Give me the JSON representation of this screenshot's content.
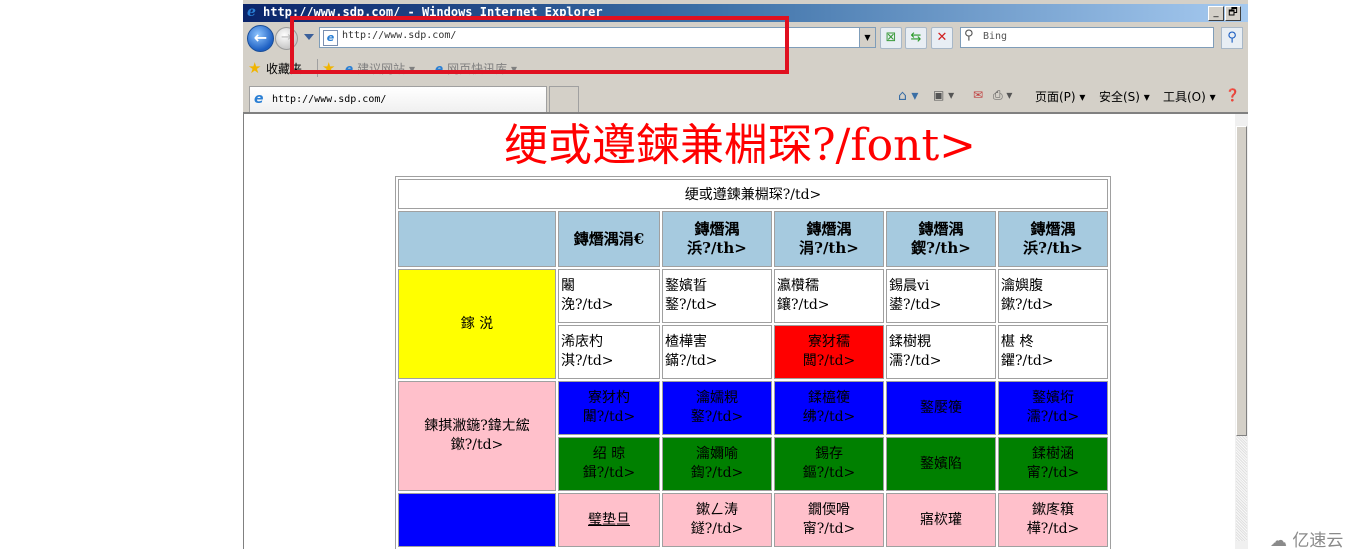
{
  "window": {
    "title": "http://www.sdp.com/ - Windows Internet Explorer",
    "controls": {
      "minimize": "_",
      "restore": "🗗"
    }
  },
  "nav": {
    "address": "http://www.sdp.com/",
    "search_placeholder": "Bing"
  },
  "favorites_bar": {
    "label": "收藏夹",
    "links": [
      {
        "label": "建议网站 ▾"
      },
      {
        "label": "网页快讯库 ▾"
      }
    ]
  },
  "tabs": [
    {
      "label": "http://www.sdp.com/"
    }
  ],
  "command_bar": {
    "page": "页面(P) ▾",
    "safety": "安全(S) ▾",
    "tools": "工具(O) ▾"
  },
  "page": {
    "heading": "绠或遵鍊兼棩琛?/font>",
    "table_caption": "绠或遵鍊兼棩琛?/td>",
    "headers": [
      "",
      "鏄熸湡涓€",
      "鏄熸湡浜?/th>",
      "鏄熸湡涓?/th>",
      "鏄熸湡鍥?/th>",
      "鏄熸湡浜?/th>"
    ],
    "groups": [
      {
        "label": "鎵  涚",
        "color": "#ffff00",
        "rows": [
          {
            "color": "#ffffff",
            "cells": [
              {
                "l1": "闂",
                "l2": "浼?/td>",
                "align": "left"
              },
              {
                "l1": "鐜嬪晢",
                "l2": "鐜?/td>",
                "align": "left"
              },
              {
                "l1": "瀛欑穤",
                "l2": "鑲?/td>",
                "align": "left"
              },
              {
                "l1": "錫晨vi",
                "l2": "鍙?/td>",
                "align": "left"
              },
              {
                "l1": "瀹嬩腹",
                "l2": "鏉?/td>",
                "align": "left"
              }
            ]
          },
          {
            "color": "#ffffff",
            "cells": [
              {
                "l1": "浠庡杓",
                "l2": "淇?/td>",
                "align": "left"
              },
              {
                "l1": "楂樺害",
                "l2": "鏋?/td>",
                "align": "left"
              },
              {
                "l1": "寮犲穤",
                "l2": "闆?/td>",
                "align": "center",
                "bg": "#ff0000"
              },
              {
                "l1": "鍒樹粯",
                "l2": "濡?/td>",
                "align": "left"
              },
              {
                "l1": "椹   柊",
                "l2": "鑺?/td>",
                "align": "left"
              }
            ]
          }
        ]
      },
      {
        "label": "鍊掑潎鍦?鍏ㄤ綋",
        "label2": "鏉?/td>",
        "color": "#ffc0cb",
        "rows": [
          {
            "color": "#0000ff",
            "cells": [
              {
                "l1": "寮犲杓",
                "l2": "闈?/td>",
                "align": "center"
              },
              {
                "l1": "瀹嬬粯",
                "l2": "鐜?/td>",
                "align": "center"
              },
              {
                "l1": "鍒橀箯",
                "l2": "绋?/td>",
                "align": "center"
              },
              {
                "l1": "鐜嬮箯",
                "l2": "",
                "align": "center"
              },
              {
                "l1": "鐜嬪垳",
                "l2": "濡?/td>",
                "align": "center"
              }
            ]
          },
          {
            "color": "#008000",
            "cells": [
              {
                "l1": "绍   晾",
                "l2": "鍓?/td>",
                "align": "center"
              },
              {
                "l1": "瀹嬭喻",
                "l2": "鍧?/td>",
                "align": "center"
              },
              {
                "l1": "錫存",
                "l2": "鏂?/td>",
                "align": "center"
              },
              {
                "l1": "鐜嬪陷",
                "l2": "",
                "align": "center"
              },
              {
                "l1": "鍒樹涵",
                "l2": "甯?/td>",
                "align": "center"
              }
            ]
          }
        ]
      },
      {
        "label": "",
        "color": "#0000ff",
        "rows": [
          {
            "color": "#ffc0cb",
            "cells": [
              {
                "l1": "璧垫旦",
                "l2": "",
                "align": "center",
                "underline": true
              },
              {
                "l1": "鏉ㄥ涛",
                "l2": "鐩?/td>",
                "align": "center"
              },
              {
                "l1": "鐗偄嗗",
                "l2": "甯?/td>",
                "align": "center"
              },
              {
                "l1": "寤栨瓘",
                "l2": "",
                "align": "center"
              },
              {
                "l1": "鏉庝簯",
                "l2": "樺?/td>",
                "align": "center"
              }
            ]
          }
        ]
      }
    ]
  },
  "watermark": "亿速云"
}
